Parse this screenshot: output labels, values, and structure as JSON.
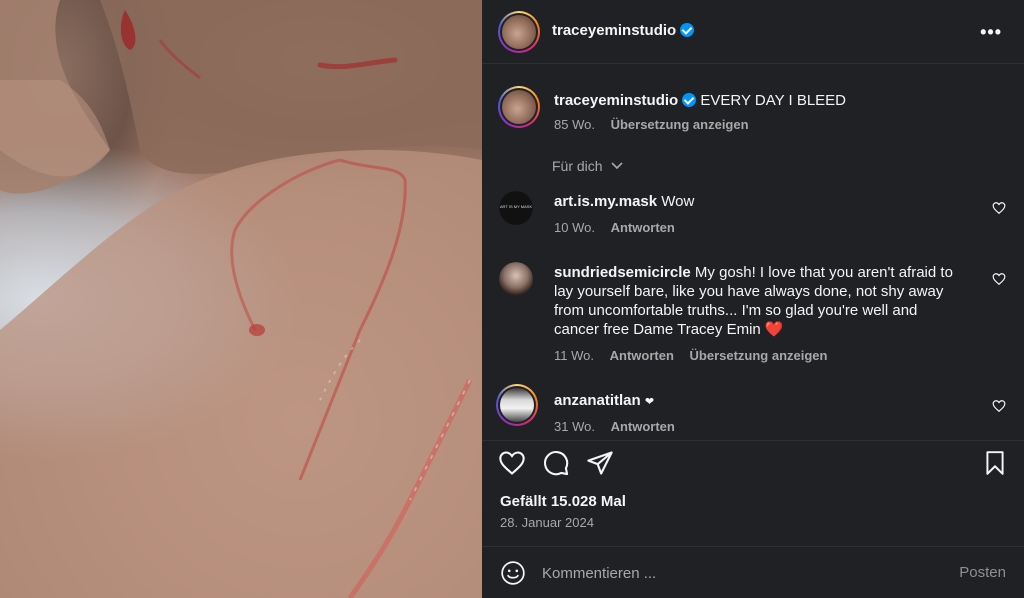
{
  "post": {
    "username": "traceyeminstudio",
    "caption": "EVERY DAY I BLEED",
    "caption_age": "85 Wo.",
    "translate_label": "Übersetzung anzeigen",
    "more_label": "•••"
  },
  "filter": {
    "label": "Für dich"
  },
  "comments": [
    {
      "username": "art.is.my.mask",
      "avatar_text": "ART IS MY MASK",
      "text": "Wow",
      "age": "10 Wo.",
      "reply_label": "Antworten"
    },
    {
      "username": "sundriedsemicircle",
      "text": "My gosh! I love that you aren't afraid to lay yourself bare, like you have always done, not shy away from uncomfortable truths... I'm so glad you're well and cancer free Dame Tracey Emin ❤️",
      "age": "11 Wo.",
      "reply_label": "Antworten",
      "translate_label": "Übersetzung anzeigen"
    },
    {
      "username": "anzanatitlan",
      "text": "❤",
      "age": "31 Wo.",
      "reply_label": "Antworten"
    }
  ],
  "actions": {
    "likes": "Gefällt 15.028 Mal",
    "date": "28. Januar 2024"
  },
  "composer": {
    "placeholder": "Kommentieren ...",
    "post_label": "Posten"
  },
  "colors": {
    "panel_bg": "#202124",
    "verified_blue": "#0095f6",
    "muted_text": "#a8a8a8"
  }
}
